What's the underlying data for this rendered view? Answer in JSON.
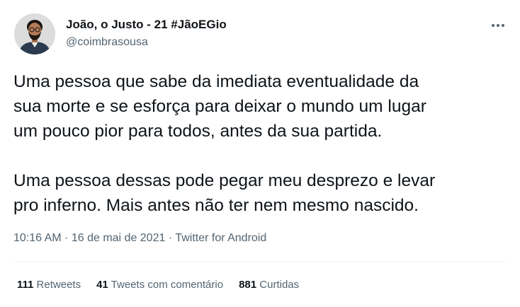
{
  "author": {
    "name": "João, o Justo - 21 #JãoEGio",
    "handle": "@coimbrasousa"
  },
  "tweet": {
    "text": "Uma pessoa que sabe da imediata eventualidade da\nsua morte e se esforça para deixar o mundo um lugar\num pouco pior para todos, antes da sua partida.\n\nUma pessoa dessas pode pegar meu desprezo e levar\npro inferno. Mais antes não ter nem mesmo nascido."
  },
  "meta": {
    "time": "10:16 AM",
    "separator1": " · ",
    "date": "16 de mai de 2021",
    "separator2": " · ",
    "source": "Twitter for Android"
  },
  "stats": {
    "retweets_count": "111",
    "retweets_label": "Retweets",
    "quotes_count": "41",
    "quotes_label": "Tweets com comentário",
    "likes_count": "881",
    "likes_label": "Curtidas"
  },
  "icons": {
    "more": "more-horizontal-icon"
  },
  "colors": {
    "text_primary": "#0f1419",
    "text_secondary": "#536471",
    "divider": "#eff3f4"
  }
}
